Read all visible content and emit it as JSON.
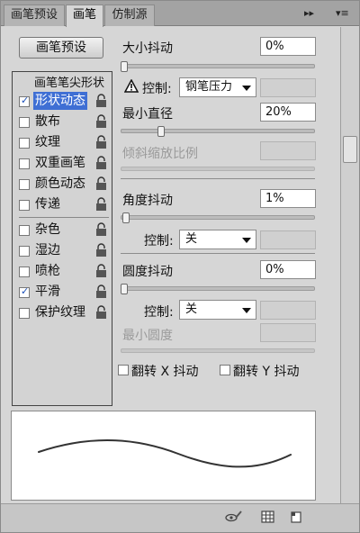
{
  "tabs": [
    {
      "label": "画笔预设",
      "active": false
    },
    {
      "label": "画笔",
      "active": true
    },
    {
      "label": "仿制源",
      "active": false
    }
  ],
  "tab_controls": {
    "collapse": "▸▸",
    "menu": "▾≡"
  },
  "preset_button": "画笔预设",
  "brush_list": {
    "header": "画笔笔尖形状",
    "items": [
      {
        "label": "形状动态",
        "checked": true,
        "selected": true
      },
      {
        "label": "散布",
        "checked": false
      },
      {
        "label": "纹理",
        "checked": false
      },
      {
        "label": "双重画笔",
        "checked": false
      },
      {
        "label": "颜色动态",
        "checked": false
      },
      {
        "label": "传递",
        "checked": false
      },
      {
        "label": "杂色",
        "checked": false
      },
      {
        "label": "湿边",
        "checked": false
      },
      {
        "label": "喷枪",
        "checked": false
      },
      {
        "label": "平滑",
        "checked": true
      },
      {
        "label": "保护纹理",
        "checked": false
      }
    ]
  },
  "size_jitter": {
    "label": "大小抖动",
    "value": "0%",
    "slider_pct": 0
  },
  "size_control": {
    "label": "控制:",
    "value": "钢笔压力"
  },
  "min_diameter": {
    "label": "最小直径",
    "value": "20%",
    "slider_pct": 20
  },
  "tilt_scale": {
    "label": "倾斜缩放比例"
  },
  "angle_jitter": {
    "label": "角度抖动",
    "value": "1%",
    "slider_pct": 1
  },
  "angle_control": {
    "label": "控制:",
    "value": "关"
  },
  "roundness_jitter": {
    "label": "圆度抖动",
    "value": "0%",
    "slider_pct": 0
  },
  "roundness_control": {
    "label": "控制:",
    "value": "关"
  },
  "min_roundness": {
    "label": "最小圆度"
  },
  "flip_x": {
    "label": "翻转 X 抖动",
    "checked": false
  },
  "flip_y": {
    "label": "翻转 Y 抖动",
    "checked": false
  },
  "bottom_icons": [
    "eye-brush-icon",
    "grid-icon",
    "new-page-icon"
  ]
}
